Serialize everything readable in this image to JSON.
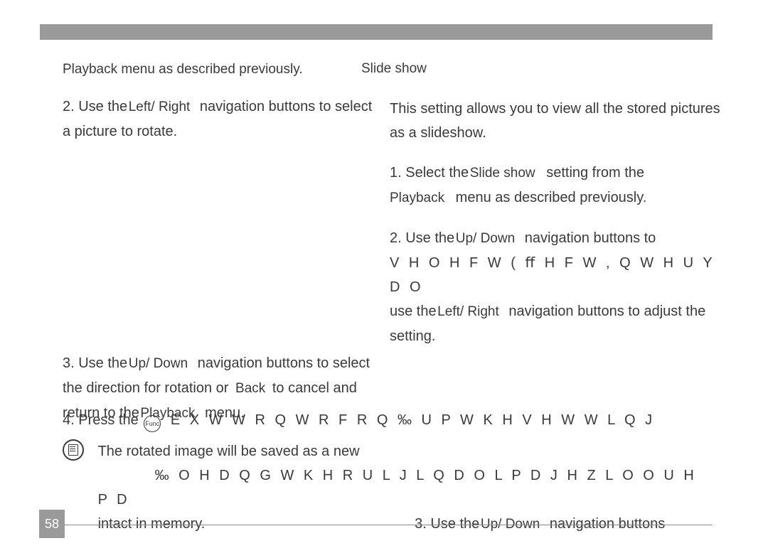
{
  "page_number": "58",
  "left": {
    "p1": "Playback    menu as described previously.",
    "p2a": "2. Use the",
    "p2b": "Left/ Right",
    "p2c": "navigation buttons to select a picture to rotate.",
    "p3a": "3. Use the",
    "p3b": "Up/ Down",
    "p3c": "navigation buttons to select the direction for rotation or",
    "p3d": "Back",
    "p3e": "to cancel and return to the",
    "p3f": "Playback",
    "p3g": "menu.",
    "p4a": "4. Press the",
    "p4c": "E X W W R Q   W R   F R Q ‰ U P   W K H   V H W W L Q J"
  },
  "right": {
    "h1": "Slide show",
    "p1": "This setting allows you to view all the stored pictures as a slideshow.",
    "p2a": "1. Select the",
    "p2b": "Slide  show",
    "p2c": "setting from the",
    "p2d": "Playback",
    "p2e": "menu as described previously.",
    "p3a": "2. Use the",
    "p3b": "Up/ Down",
    "p3c": "navigation buttons to",
    "p3d": "V H O H F W   ( ﬀ H F W     , Q W H U Y D O",
    "p3e": "use the",
    "p3f": "Left/ Right",
    "p3g": "navigation buttons to adjust the setting.",
    "p4a": "3. Use the",
    "p4b": "Up/ Down",
    "p4c": "navigation buttons"
  },
  "note": {
    "l1": "The rotated image will be saved as a new",
    "l2": "‰ O H   D Q G   W K H   R U L J L Q D O   L P D J H   Z L O O   U H P D",
    "l3": "intact in memory."
  },
  "func_label": "Func"
}
